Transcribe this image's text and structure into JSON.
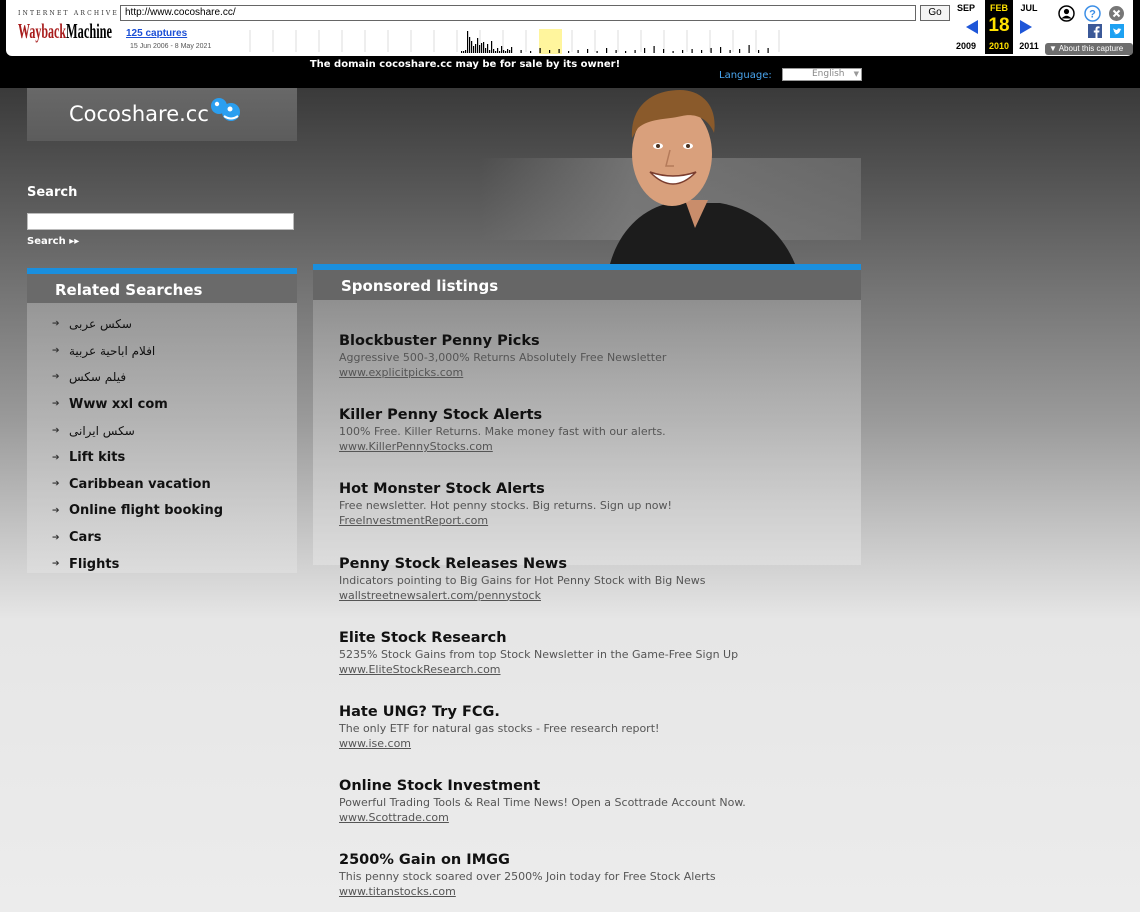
{
  "wayback": {
    "brand_top": "INTERNET ARCHIVE",
    "brand": "WaybackMachine",
    "url": "http://www.cocoshare.cc/",
    "go_label": "Go",
    "captures": "125 captures",
    "range": "15 Jun 2006 - 8 May 2021",
    "prev_month": "SEP",
    "cur_month": "FEB",
    "next_month": "JUL",
    "cur_day": "18",
    "prev_year": "2009",
    "cur_year": "2010",
    "next_year": "2011",
    "about": "About this capture",
    "spark_heights": [
      2,
      2,
      3,
      22,
      16,
      12,
      7,
      9,
      15,
      8,
      10,
      11,
      5,
      9,
      3,
      12,
      4,
      2,
      5,
      2,
      7,
      3,
      2,
      4,
      3,
      6,
      3,
      2,
      5,
      3,
      4,
      2,
      3,
      4,
      2,
      5,
      3,
      2,
      3,
      5,
      7,
      4,
      2,
      3,
      4,
      3,
      5,
      6,
      3,
      4,
      8,
      3,
      5
    ]
  },
  "banner": {
    "forsale": "The domain cocoshare.cc may be for sale by its owner!",
    "language_label": "Language:",
    "language_value": "English"
  },
  "site": {
    "name": "Cocoshare.cc"
  },
  "search": {
    "title": "Search",
    "button": "Search ▸▸"
  },
  "related": {
    "title": "Related Searches",
    "items": [
      {
        "label": "سكس عربى",
        "rtl": true
      },
      {
        "label": "افلام اباحية عربية",
        "rtl": true
      },
      {
        "label": "فيلم سكس",
        "rtl": true
      },
      {
        "label": "Www xxl com",
        "rtl": false
      },
      {
        "label": "سكس ايرانى",
        "rtl": true
      },
      {
        "label": "Lift kits",
        "rtl": false
      },
      {
        "label": "Caribbean vacation",
        "rtl": false
      },
      {
        "label": "Online flight booking",
        "rtl": false
      },
      {
        "label": "Cars",
        "rtl": false
      },
      {
        "label": "Flights",
        "rtl": false
      }
    ]
  },
  "sponsored": {
    "title": "Sponsored listings",
    "ads": [
      {
        "title": "Blockbuster Penny Picks",
        "desc": "Aggressive 500-3,000% Returns Absolutely Free Newsletter",
        "url": "www.explicitpicks.com"
      },
      {
        "title": "Killer Penny Stock Alerts",
        "desc": "100% Free. Killer Returns. Make money fast with our alerts.",
        "url": "www.KillerPennyStocks.com"
      },
      {
        "title": "Hot Monster Stock Alerts",
        "desc": "Free newsletter. Hot penny stocks. Big returns. Sign up now!",
        "url": "FreeInvestmentReport.com"
      },
      {
        "title": "Penny Stock Releases News",
        "desc": "Indicators pointing to Big Gains for Hot Penny Stock with Big News",
        "url": "wallstreetnewsalert.com/pennystock"
      },
      {
        "title": "Elite Stock Research",
        "desc": "5235% Stock Gains from top Stock Newsletter in the Game-Free Sign Up",
        "url": "www.EliteStockResearch.com"
      },
      {
        "title": "Hate UNG? Try FCG.",
        "desc": "The only ETF for natural gas stocks - Free research report!",
        "url": "www.ise.com"
      },
      {
        "title": "Online Stock Investment",
        "desc": "Powerful Trading Tools & Real Time News! Open a Scottrade Account Now.",
        "url": "www.Scottrade.com"
      },
      {
        "title": "2500% Gain on IMGG",
        "desc": "This penny stock soared over 2500% Join today for Free Stock Alerts",
        "url": "www.titanstocks.com"
      }
    ]
  },
  "colors": {
    "accent": "#1a8fde",
    "wayback_blue": "#1e56d8",
    "wayback_yellow": "#ffe100"
  }
}
